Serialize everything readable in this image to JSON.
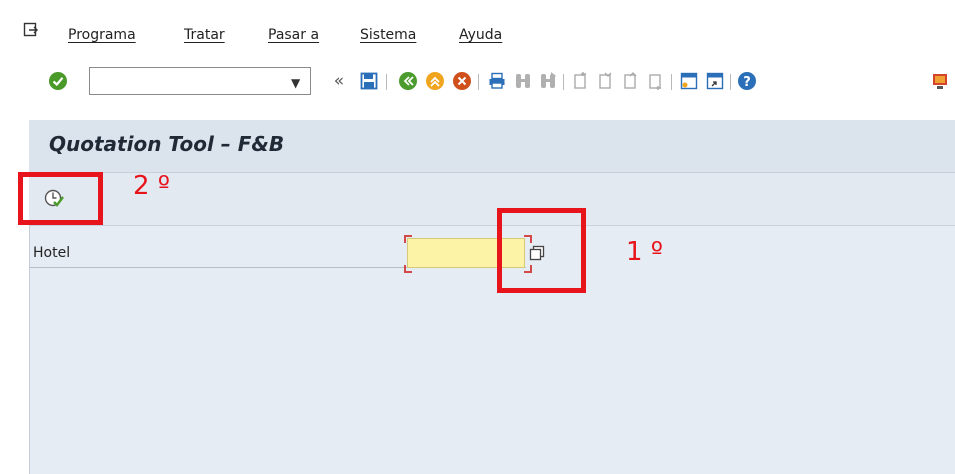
{
  "menubar": {
    "items": [
      "Programa",
      "Tratar",
      "Pasar a",
      "Sistema",
      "Ayuda"
    ]
  },
  "toolbar": {
    "command_field_value": "",
    "icons": [
      "enter-icon",
      "command-dropdown-icon",
      "collapse-icon",
      "save-icon",
      "back-icon",
      "exit-icon",
      "cancel-icon",
      "print-icon",
      "find-icon",
      "find-next-icon",
      "first-page-icon",
      "previous-page-icon",
      "next-page-icon",
      "last-page-icon",
      "new-session-icon",
      "shortcut-icon",
      "help-icon",
      "customize-layout-icon"
    ]
  },
  "screen": {
    "title": "Quotation Tool – F&B",
    "execute_icon": "execute-icon"
  },
  "form": {
    "hotel_label": "Hotel",
    "hotel_value": "",
    "multiple_selection_icon": "multiple-selection-icon"
  },
  "annotations": {
    "first": "1 º",
    "second": "2 º"
  },
  "colors": {
    "accent_red": "#e8141b",
    "workarea_bg": "#e5ecf3",
    "required_field_bg": "#fdf3a6"
  }
}
